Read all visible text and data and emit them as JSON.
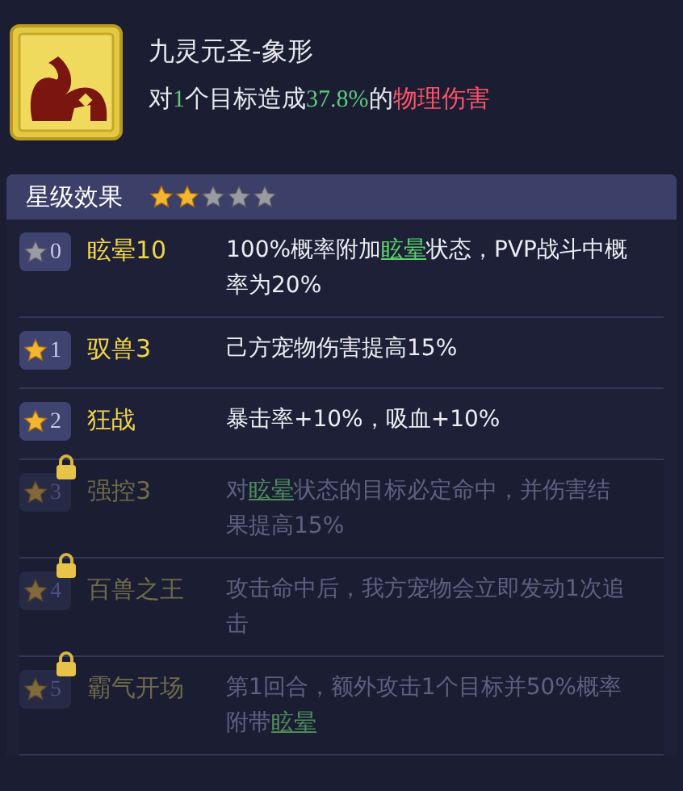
{
  "skill": {
    "name": "九灵元圣-象形",
    "description": [
      {
        "kind": "plain",
        "text": "对"
      },
      {
        "kind": "number",
        "text": "1"
      },
      {
        "kind": "plain",
        "text": "个目标造成"
      },
      {
        "kind": "number",
        "text": "37.8%"
      },
      {
        "kind": "plain",
        "text": "的"
      },
      {
        "kind": "damage",
        "text": "物理伤害"
      }
    ]
  },
  "star_section": {
    "title": "星级效果",
    "stars": 2
  },
  "effects": [
    {
      "number": "0",
      "star_lit": false,
      "locked": false,
      "name": "眩晕10",
      "description": [
        {
          "kind": "plain",
          "text": "100%概率附加"
        },
        {
          "kind": "link",
          "text": "眩晕"
        },
        {
          "kind": "plain",
          "text": "状态，PVP战斗中概率为20%"
        }
      ]
    },
    {
      "number": "1",
      "star_lit": true,
      "locked": false,
      "name": "驭兽3",
      "description": [
        {
          "kind": "plain",
          "text": "己方宠物伤害提高15%"
        }
      ]
    },
    {
      "number": "2",
      "star_lit": true,
      "locked": false,
      "name": "狂战",
      "description": [
        {
          "kind": "plain",
          "text": "暴击率+10%，吸血+10%"
        }
      ]
    },
    {
      "number": "3",
      "star_lit": true,
      "locked": true,
      "name": "强控3",
      "description": [
        {
          "kind": "plain",
          "text": "对"
        },
        {
          "kind": "link",
          "text": "眩晕"
        },
        {
          "kind": "plain",
          "text": "状态的目标必定命中，并伤害结果提高15%"
        }
      ]
    },
    {
      "number": "4",
      "star_lit": true,
      "locked": true,
      "name": "百兽之王",
      "description": [
        {
          "kind": "plain",
          "text": "攻击命中后，我方宠物会立即发动1次追击"
        }
      ]
    },
    {
      "number": "5",
      "star_lit": true,
      "locked": true,
      "name": "霸气开场",
      "description": [
        {
          "kind": "plain",
          "text": "第1回合，额外攻击1个目标并50%概率附带"
        },
        {
          "kind": "link",
          "text": "眩晕"
        }
      ]
    }
  ]
}
